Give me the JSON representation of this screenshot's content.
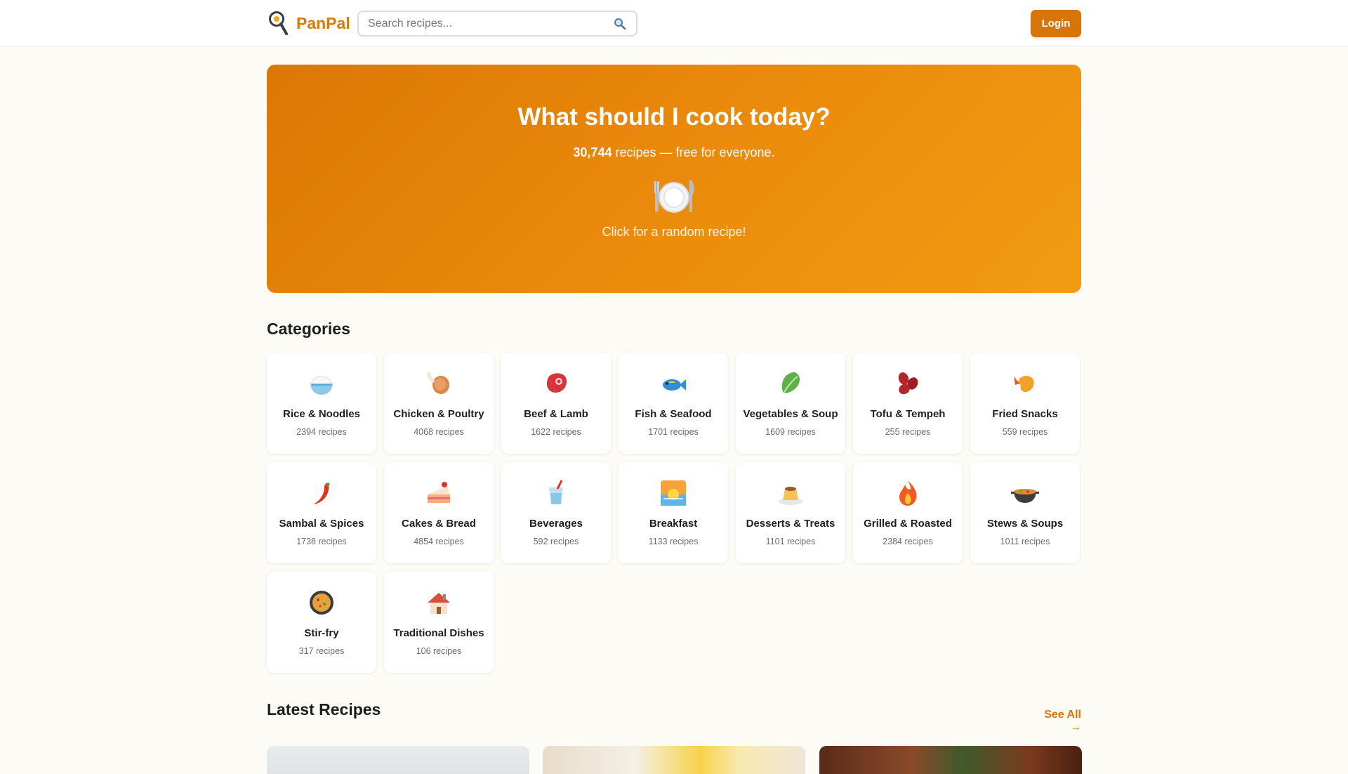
{
  "app": {
    "brand": "PanPal",
    "accent": "#d5750a"
  },
  "header": {
    "search_placeholder": "Search recipes...",
    "login_label": "Login"
  },
  "hero": {
    "title": "What should I cook today?",
    "recipe_count": "30,744",
    "subtitle_rest": " recipes — free for everyone.",
    "cta": "Click for a random recipe!",
    "icon": "plate-cutlery-icon"
  },
  "categories": {
    "title": "Categories",
    "items": [
      {
        "name": "Rice & Noodles",
        "count": "2394 recipes",
        "icon": "rice-bowl-icon"
      },
      {
        "name": "Chicken & Poultry",
        "count": "4068 recipes",
        "icon": "chicken-leg-icon"
      },
      {
        "name": "Beef & Lamb",
        "count": "1622 recipes",
        "icon": "meat-icon"
      },
      {
        "name": "Fish & Seafood",
        "count": "1701 recipes",
        "icon": "fish-icon"
      },
      {
        "name": "Vegetables & Soup",
        "count": "1609 recipes",
        "icon": "leafy-green-icon"
      },
      {
        "name": "Tofu & Tempeh",
        "count": "255 recipes",
        "icon": "beans-icon"
      },
      {
        "name": "Fried Snacks",
        "count": "559 recipes",
        "icon": "fried-shrimp-icon"
      },
      {
        "name": "Sambal & Spices",
        "count": "1738 recipes",
        "icon": "chili-icon"
      },
      {
        "name": "Cakes & Bread",
        "count": "4854 recipes",
        "icon": "cake-icon"
      },
      {
        "name": "Beverages",
        "count": "592 recipes",
        "icon": "cup-straw-icon"
      },
      {
        "name": "Breakfast",
        "count": "1133 recipes",
        "icon": "sunrise-icon"
      },
      {
        "name": "Desserts & Treats",
        "count": "1101 recipes",
        "icon": "custard-icon"
      },
      {
        "name": "Grilled & Roasted",
        "count": "2384 recipes",
        "icon": "fire-icon"
      },
      {
        "name": "Stews & Soups",
        "count": "1011 recipes",
        "icon": "stew-pot-icon"
      },
      {
        "name": "Stir-fry",
        "count": "317 recipes",
        "icon": "paella-pan-icon"
      },
      {
        "name": "Traditional Dishes",
        "count": "106 recipes",
        "icon": "house-icon"
      }
    ]
  },
  "latest": {
    "title": "Latest Recipes",
    "see_all": "See All →"
  }
}
